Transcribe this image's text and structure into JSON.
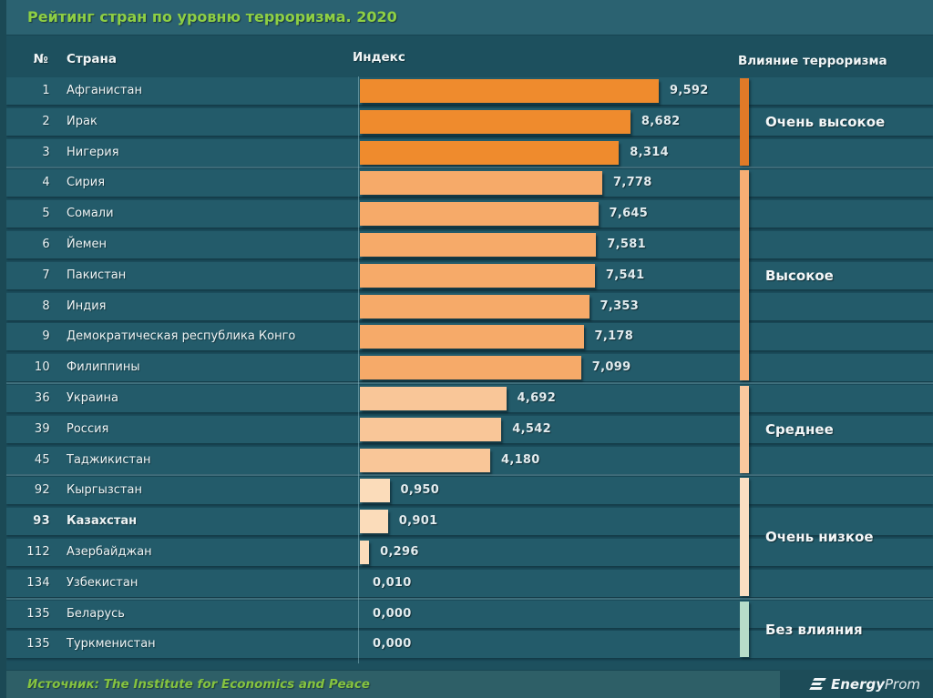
{
  "title": "Рейтинг стран по уровню терроризма. 2020",
  "header": {
    "rank": "№",
    "country": "Страна",
    "index": "Индекс",
    "impact": "Влияние терроризма"
  },
  "footer": {
    "source": "Источник: The Institute for Economics and Peace",
    "logo_energy": "Energy",
    "logo_prom": "Prom"
  },
  "colors": {
    "background": "#1d505e",
    "title_strip": "#2b6271",
    "row_band": "#235b6a",
    "title_green": "#8ecf44",
    "bar_very_high": "#ef8b2d",
    "bar_high": "#f6aa69",
    "bar_medium": "#f9c698",
    "bar_very_low": "#fbdcba",
    "indicator_very_high": "#e07a28",
    "indicator_high": "#f6ae74",
    "indicator_medium": "#f9c89e",
    "indicator_very_low": "#fadec2",
    "indicator_none": "#b7dcc9"
  },
  "chart_data": {
    "type": "bar",
    "orientation": "horizontal",
    "title": "Рейтинг стран по уровню терроризма. 2020",
    "xlabel": "Индекс",
    "value_range": [
      0,
      9.592
    ],
    "legend_position": "right",
    "grid": false,
    "groups": [
      {
        "label": "Очень высокое",
        "bar_color": "#ef8b2d",
        "indicator_color": "#e07a28",
        "start": 0,
        "end": 2
      },
      {
        "label": "Высокое",
        "bar_color": "#f6aa69",
        "indicator_color": "#f6ae74",
        "start": 3,
        "end": 9
      },
      {
        "label": "Среднее",
        "bar_color": "#f9c698",
        "indicator_color": "#f9c89e",
        "start": 10,
        "end": 12
      },
      {
        "label": "Очень низкое",
        "bar_color": "#fbdcba",
        "indicator_color": "#fadec2",
        "start": 13,
        "end": 16
      },
      {
        "label": "Без влияния",
        "bar_color": null,
        "indicator_color": "#b7dcc9",
        "start": 17,
        "end": 18
      }
    ],
    "rows": [
      {
        "rank": "1",
        "country": "Афганистан",
        "value": 9.592,
        "display": "9,592"
      },
      {
        "rank": "2",
        "country": "Ирак",
        "value": 8.682,
        "display": "8,682"
      },
      {
        "rank": "3",
        "country": "Нигерия",
        "value": 8.314,
        "display": "8,314"
      },
      {
        "rank": "4",
        "country": "Сирия",
        "value": 7.778,
        "display": "7,778"
      },
      {
        "rank": "5",
        "country": "Сомали",
        "value": 7.645,
        "display": "7,645"
      },
      {
        "rank": "6",
        "country": "Йемен",
        "value": 7.581,
        "display": "7,581"
      },
      {
        "rank": "7",
        "country": "Пакистан",
        "value": 7.541,
        "display": "7,541"
      },
      {
        "rank": "8",
        "country": "Индия",
        "value": 7.353,
        "display": "7,353"
      },
      {
        "rank": "9",
        "country": "Демократическая республика Конго",
        "value": 7.178,
        "display": "7,178"
      },
      {
        "rank": "10",
        "country": "Филиппины",
        "value": 7.099,
        "display": "7,099"
      },
      {
        "rank": "36",
        "country": "Украина",
        "value": 4.692,
        "display": "4,692"
      },
      {
        "rank": "39",
        "country": "Россия",
        "value": 4.542,
        "display": "4,542"
      },
      {
        "rank": "45",
        "country": "Таджикистан",
        "value": 4.18,
        "display": "4,180"
      },
      {
        "rank": "92",
        "country": "Кыргызстан",
        "value": 0.95,
        "display": "0,950"
      },
      {
        "rank": "93",
        "country": "Казахстан",
        "value": 0.901,
        "display": "0,901",
        "bold": true
      },
      {
        "rank": "112",
        "country": "Азербайджан",
        "value": 0.296,
        "display": "0,296"
      },
      {
        "rank": "134",
        "country": "Узбекистан",
        "value": 0.01,
        "display": "0,010"
      },
      {
        "rank": "135",
        "country": "Беларусь",
        "value": 0.0,
        "display": "0,000"
      },
      {
        "rank": "135",
        "country": "Туркменистан",
        "value": 0.0,
        "display": "0,000"
      }
    ]
  }
}
